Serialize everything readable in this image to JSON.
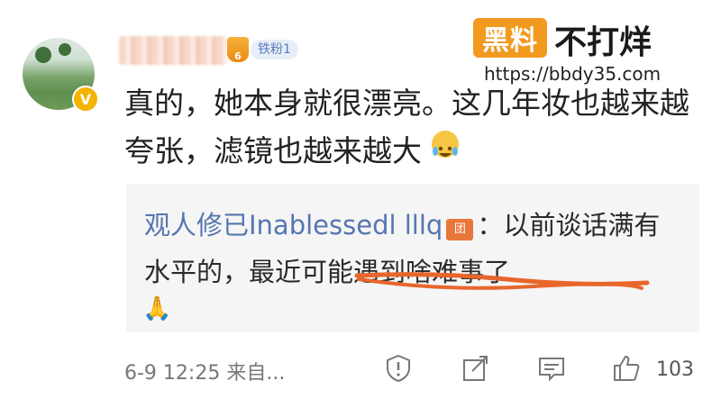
{
  "watermark": {
    "badge_text": "黑料",
    "tagline": "不打烊",
    "url": "https://bbdy35.com"
  },
  "comment": {
    "fan_badge_label": "铁粉1",
    "fan_badge_level": "6",
    "body": "真的，她本身就很漂亮。这几年妆也越来越夸张，滤镜也越来越大",
    "emoji": "laugh-cry-emoji"
  },
  "reply": {
    "author": "观人修已Inablessedl lllq",
    "colon": "：以前谈话满有水平的，",
    "highlighted": "最近可能遇到啥难事了",
    "trailing_emoji": "🙏"
  },
  "footer": {
    "time": "6-9 12:25",
    "source": "来自...",
    "like_count": "103"
  },
  "colors": {
    "accent_orange": "#f29a1f",
    "reply_link_blue": "#5576b0",
    "underline_orange": "#e8662b",
    "reply_bg": "#f5f5f5"
  }
}
